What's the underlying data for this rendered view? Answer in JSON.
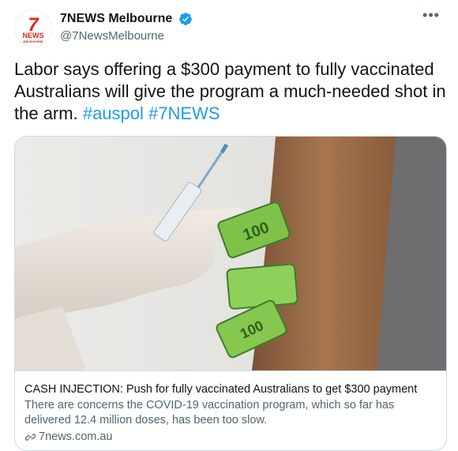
{
  "account": {
    "logo_text": "7",
    "logo_sub": "NEWS",
    "logo_city": "MELBOURNE",
    "display_name": "7NEWS Melbourne",
    "handle": "@7NewsMelbourne",
    "verified": true
  },
  "tweet": {
    "text": "Labor says offering a $300 payment to fully vaccinated Australians will give the program a much-needed shot in the arm.",
    "hashtags": [
      "#auspol",
      "#7NEWS"
    ]
  },
  "card": {
    "banknote_label": "100",
    "title": "CASH INJECTION: Push for fully vaccinated Australians to get $300 payment",
    "description": "There are concerns the COVID-19 vaccination program, which so far has delivered 12.4 million doses, has been too slow.",
    "domain": "7news.com.au"
  },
  "colors": {
    "brand_red": "#e2231a",
    "link_blue": "#1d9bf0",
    "verified_blue": "#1d9bf0",
    "muted": "#536471"
  },
  "icons": {
    "more": "more-horizontal-icon",
    "verified": "verified-badge-icon",
    "link": "link-icon"
  }
}
